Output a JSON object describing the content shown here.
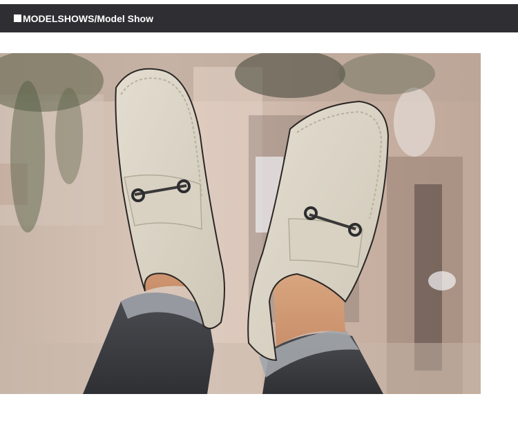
{
  "header": {
    "title": "MODELSHOWS/Model Show",
    "square_icon": "square-bullet-icon",
    "background_color": "#2f2f33",
    "text_color": "#ffffff"
  },
  "photo": {
    "subject": "model-show-photo",
    "shoe_color": "#d8d3c6"
  }
}
